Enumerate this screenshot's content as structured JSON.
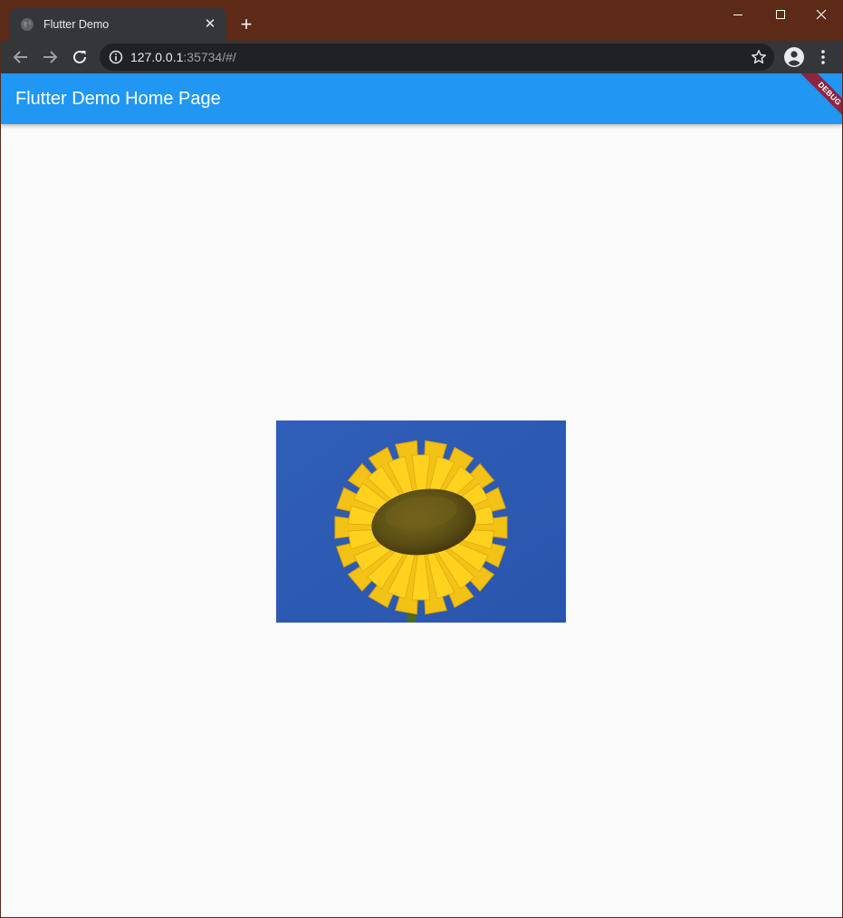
{
  "browser": {
    "tab": {
      "title": "Flutter Demo",
      "close_label": "✕",
      "favicon": "globe-icon"
    },
    "new_tab_label": "+",
    "address": {
      "host": "127.0.0.1",
      "rest": ":35734/#/"
    }
  },
  "app": {
    "title": "Flutter Demo Home Page",
    "debug_label": "DEBUG",
    "appbar_color": "#2196f3",
    "image": "sunflower"
  }
}
